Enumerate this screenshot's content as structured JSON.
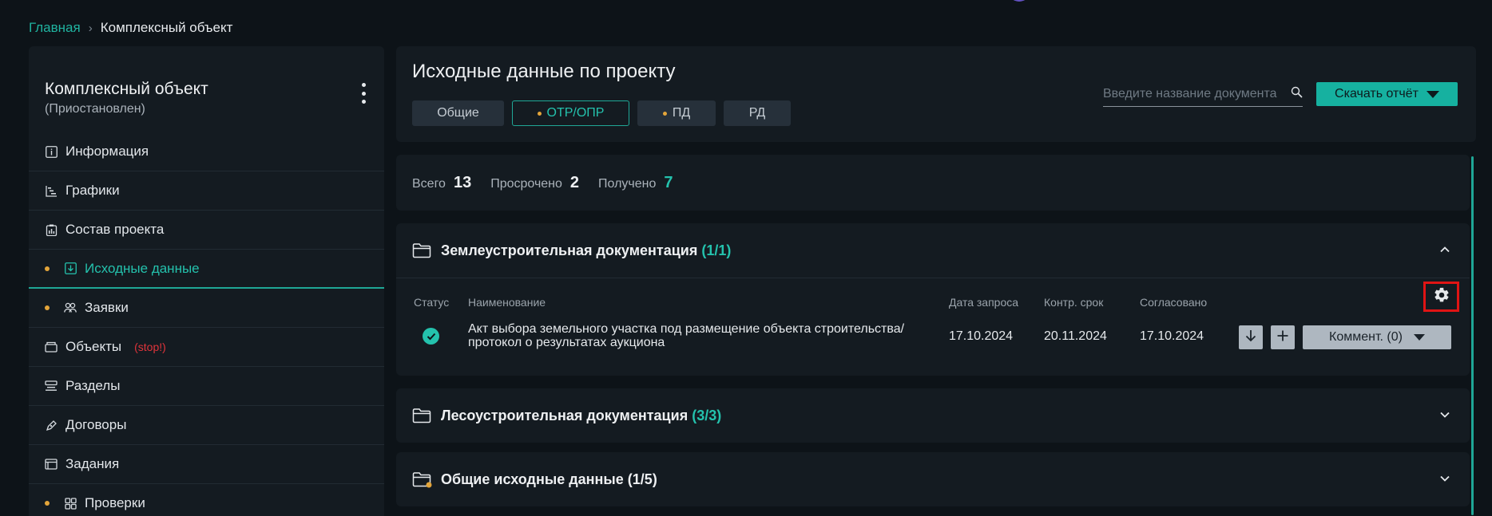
{
  "breadcrumb": {
    "home": "Главная",
    "current": "Комплексный объект"
  },
  "sidebar": {
    "title": "Комплексный объект",
    "status": "(Приостановлен)",
    "items": [
      {
        "label": "Информация",
        "icon": "info-icon"
      },
      {
        "label": "Графики",
        "icon": "gantt-icon"
      },
      {
        "label": "Состав проекта",
        "icon": "clipboard-chart-icon"
      },
      {
        "label": "Исходные данные",
        "icon": "download-box-icon",
        "active": true,
        "dot": true
      },
      {
        "label": "Заявки",
        "icon": "people-icon",
        "dot": true
      },
      {
        "label": "Объекты",
        "icon": "box-icon",
        "badge": "(stop!)"
      },
      {
        "label": "Разделы",
        "icon": "sections-icon"
      },
      {
        "label": "Договоры",
        "icon": "pen-icon"
      },
      {
        "label": "Задания",
        "icon": "tasks-icon"
      },
      {
        "label": "Проверки",
        "icon": "grid-icon",
        "dot": true
      }
    ]
  },
  "header": {
    "title": "Исходные данные по проекту",
    "tabs": [
      {
        "label": "Общие"
      },
      {
        "label": "ОТР/ОПР",
        "active": true,
        "dot": true
      },
      {
        "label": "ПД",
        "dot": true
      },
      {
        "label": "РД"
      }
    ],
    "search_placeholder": "Введите название документа",
    "download_label": "Скачать отчёт"
  },
  "stats": {
    "total_label": "Всего",
    "total": "13",
    "overdue_label": "Просрочено",
    "overdue": "2",
    "received_label": "Получено",
    "received": "7"
  },
  "sections": [
    {
      "title": "Землеустроительная документация",
      "count": "(1/1)",
      "expanded": true,
      "columns": [
        "Статус",
        "Наименование",
        "Дата запроса",
        "Контр. срок",
        "Согласовано"
      ],
      "rows": [
        {
          "name_line1": "Акт выбора земельного участка под размещение объекта строительства/",
          "name_line2": "протокол о результатах аукциона",
          "request_date": "17.10.2024",
          "deadline": "20.11.2024",
          "approved": "17.10.2024",
          "comment_label": "Коммент. (0)"
        }
      ]
    },
    {
      "title": "Лесоустроительная документация",
      "count": "(3/3)",
      "expanded": false
    },
    {
      "title": "Общие исходные данные",
      "count": "(1/5)",
      "expanded": false
    }
  ],
  "colors": {
    "accent": "#16b1a0",
    "dot": "#e3a53a",
    "stop": "#e0343b",
    "highlight": "#e01414"
  }
}
